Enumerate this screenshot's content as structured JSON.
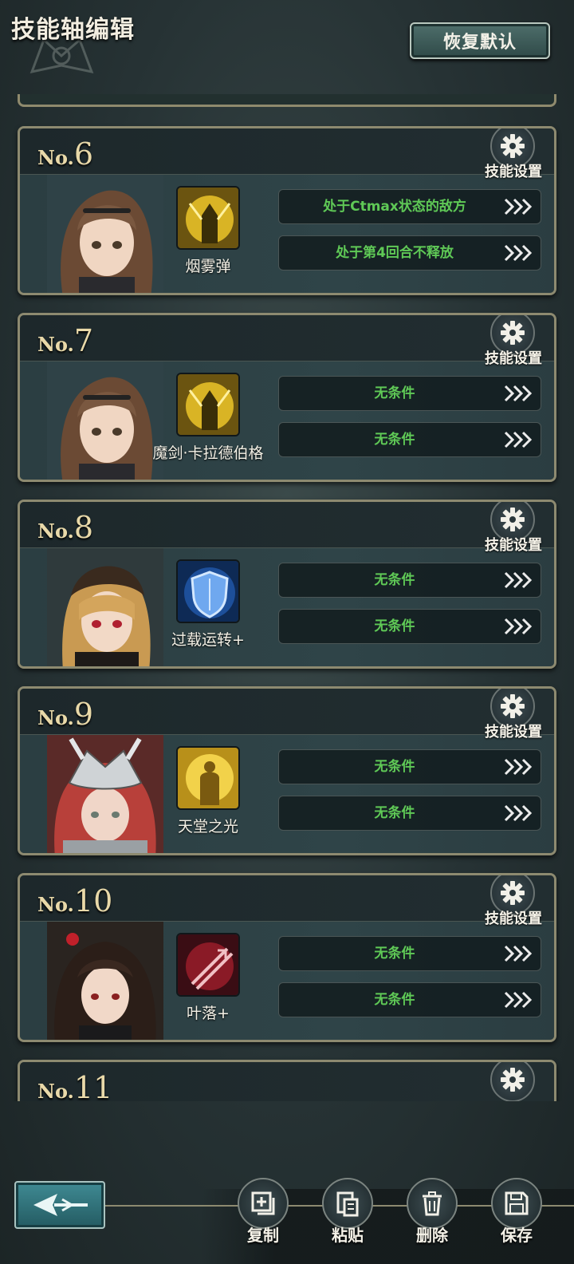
{
  "header": {
    "title": "技能轴编辑",
    "reset_label": "恢复默认"
  },
  "settings_label": "技能设置",
  "entries": [
    {
      "no_prefix": "No.",
      "number": "6",
      "skill": "烟雾弹",
      "conditions": [
        "处于Ctmax状态的敌方",
        "处于第4回合不释放"
      ]
    },
    {
      "no_prefix": "No.",
      "number": "7",
      "skill": "魔剑·卡拉德伯格",
      "conditions": [
        "无条件",
        "无条件"
      ]
    },
    {
      "no_prefix": "No.",
      "number": "8",
      "skill": "过载运转+",
      "conditions": [
        "无条件",
        "无条件"
      ]
    },
    {
      "no_prefix": "No.",
      "number": "9",
      "skill": "天堂之光",
      "conditions": [
        "无条件",
        "无条件"
      ]
    },
    {
      "no_prefix": "No.",
      "number": "10",
      "skill": "叶落+",
      "conditions": [
        "无条件",
        "无条件"
      ]
    },
    {
      "no_prefix": "No.",
      "number": "11"
    }
  ],
  "actions": {
    "copy": "复制",
    "paste": "粘贴",
    "delete": "删除",
    "save": "保存"
  },
  "colors": {
    "condition_text": "#5fc956",
    "number_gold": "#e9d9a9",
    "card_border": "#8d8a70"
  }
}
